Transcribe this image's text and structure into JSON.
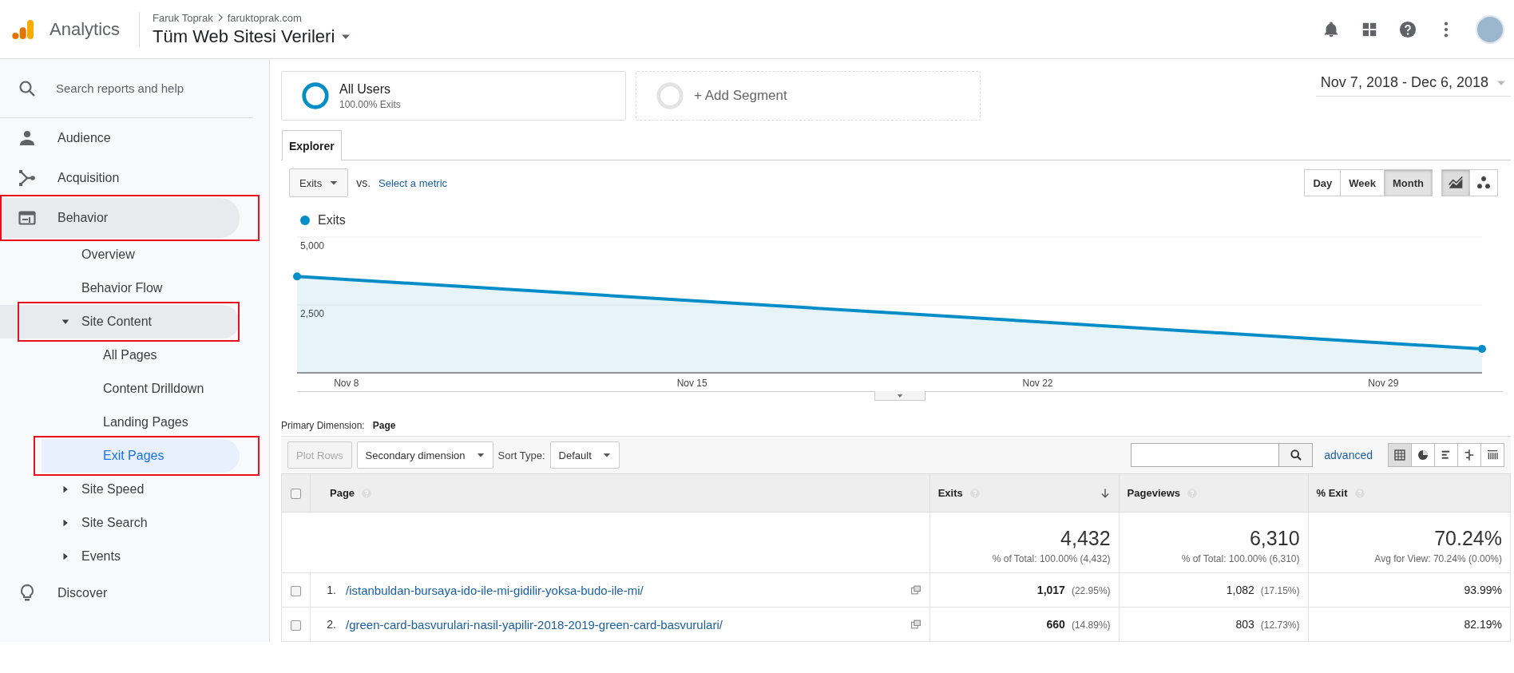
{
  "header": {
    "product": "Analytics",
    "account": "Faruk Toprak",
    "property": "faruktoprak.com",
    "view": "Tüm Web Sitesi Verileri"
  },
  "sidebar": {
    "search_placeholder": "Search reports and help",
    "items": [
      {
        "label": "Audience",
        "kind": "person",
        "selected": false,
        "active": false,
        "highlighted": false
      },
      {
        "label": "Acquisition",
        "kind": "acquisition",
        "selected": false,
        "active": false,
        "highlighted": false
      },
      {
        "label": "Behavior",
        "kind": "behavior",
        "selected": false,
        "active": true,
        "highlighted": true,
        "children": [
          {
            "label": "Overview",
            "selected": false,
            "active": false,
            "highlighted": false
          },
          {
            "label": "Behavior Flow",
            "selected": false,
            "active": false,
            "highlighted": false
          },
          {
            "label": "Site Content",
            "selected": false,
            "active": true,
            "highlighted": true,
            "expanded": true,
            "children": [
              {
                "label": "All Pages",
                "selected": false,
                "active": false,
                "highlighted": false
              },
              {
                "label": "Content Drilldown",
                "selected": false,
                "active": false,
                "highlighted": false
              },
              {
                "label": "Landing Pages",
                "selected": false,
                "active": false,
                "highlighted": false
              },
              {
                "label": "Exit Pages",
                "selected": true,
                "active": false,
                "highlighted": true
              }
            ]
          },
          {
            "label": "Site Speed",
            "selected": false,
            "active": false,
            "highlighted": false,
            "expanded": false
          },
          {
            "label": "Site Search",
            "selected": false,
            "active": false,
            "highlighted": false,
            "expanded": false
          },
          {
            "label": "Events",
            "selected": false,
            "active": false,
            "highlighted": false,
            "expanded": false
          }
        ]
      },
      {
        "label": "Discover",
        "kind": "bulb",
        "selected": false,
        "active": false,
        "highlighted": false
      }
    ]
  },
  "segments": [
    {
      "kind": "segment",
      "label": "All Users",
      "detail": "100.00% Exits"
    },
    {
      "kind": "add",
      "label": "+ Add Segment"
    }
  ],
  "date_range": "Nov 7, 2018 - Dec 6, 2018",
  "tabs": [
    {
      "label": "Explorer",
      "selected": true
    }
  ],
  "metric": {
    "value": "Exits",
    "vs": "vs.",
    "link": "Select a metric"
  },
  "granularity": [
    {
      "label": "Day",
      "selected": false
    },
    {
      "label": "Week",
      "selected": false
    },
    {
      "label": "Month",
      "selected": true
    }
  ],
  "chart_modes": [
    {
      "kind": "line",
      "selected": true
    },
    {
      "kind": "motion",
      "selected": false
    }
  ],
  "chart": {
    "chart_data": {
      "type": "area",
      "categories": [
        null,
        "Nov 8",
        null,
        null,
        null,
        null,
        null,
        null,
        "Nov 15",
        null,
        null,
        null,
        null,
        null,
        null,
        "Nov 22",
        null,
        null,
        null,
        null,
        null,
        null,
        "Nov 29",
        null,
        null
      ],
      "series": [
        {
          "name": "Exits",
          "color": "#058dc7",
          "values": [
            3550,
            null,
            null,
            null,
            null,
            null,
            null,
            null,
            null,
            null,
            null,
            null,
            null,
            null,
            null,
            null,
            null,
            null,
            null,
            null,
            null,
            null,
            null,
            null,
            880
          ]
        }
      ],
      "ylim": [
        0,
        5000
      ],
      "yticks": [
        {
          "value": 2500,
          "label": "2,500"
        },
        {
          "value": 5000,
          "label": "5,000"
        }
      ]
    }
  },
  "primary_dimension": {
    "label": "Primary Dimension:",
    "value": "Page"
  },
  "toolbar": {
    "plot_rows": {
      "label": "Plot Rows",
      "disabled": true
    },
    "secondary": "Secondary dimension",
    "sort_label": "Sort Type:",
    "sort_value": "Default",
    "advanced": "advanced",
    "views": [
      {
        "kind": "table",
        "selected": true
      },
      {
        "kind": "pie",
        "selected": false
      },
      {
        "kind": "bars",
        "selected": false
      },
      {
        "kind": "compare",
        "selected": false
      },
      {
        "kind": "pivot",
        "selected": false
      }
    ]
  },
  "table": {
    "select_all_checked": false,
    "columns": [
      {
        "label": "Page",
        "sorted": false
      },
      {
        "label": "Exits",
        "sorted": true
      },
      {
        "label": "Pageviews",
        "sorted": false
      },
      {
        "label": "% Exit",
        "sorted": false
      }
    ],
    "totals": [
      {
        "value": "4,432",
        "note": "% of Total: 100.00% (4,432)"
      },
      {
        "value": "6,310",
        "note": "% of Total: 100.00% (6,310)"
      },
      {
        "value": "70.24%",
        "note": "Avg for View: 70.24% (0.00%)"
      }
    ],
    "rows": [
      {
        "checked": false,
        "index": "1.",
        "page": "/istanbuldan-bursaya-ido-ile-mi-gidilir-yoksa-budo-ile-mi/",
        "exits": "1,017",
        "exits_share": "(22.95%)",
        "pageviews": "1,082",
        "pageviews_share": "(17.15%)",
        "exit_rate": "93.99%"
      },
      {
        "checked": false,
        "index": "2.",
        "page": "/green-card-basvurulari-nasil-yapilir-2018-2019-green-card-basvurulari/",
        "exits": "660",
        "exits_share": "(14.89%)",
        "pageviews": "803",
        "pageviews_share": "(12.73%)",
        "exit_rate": "82.19%"
      }
    ]
  }
}
